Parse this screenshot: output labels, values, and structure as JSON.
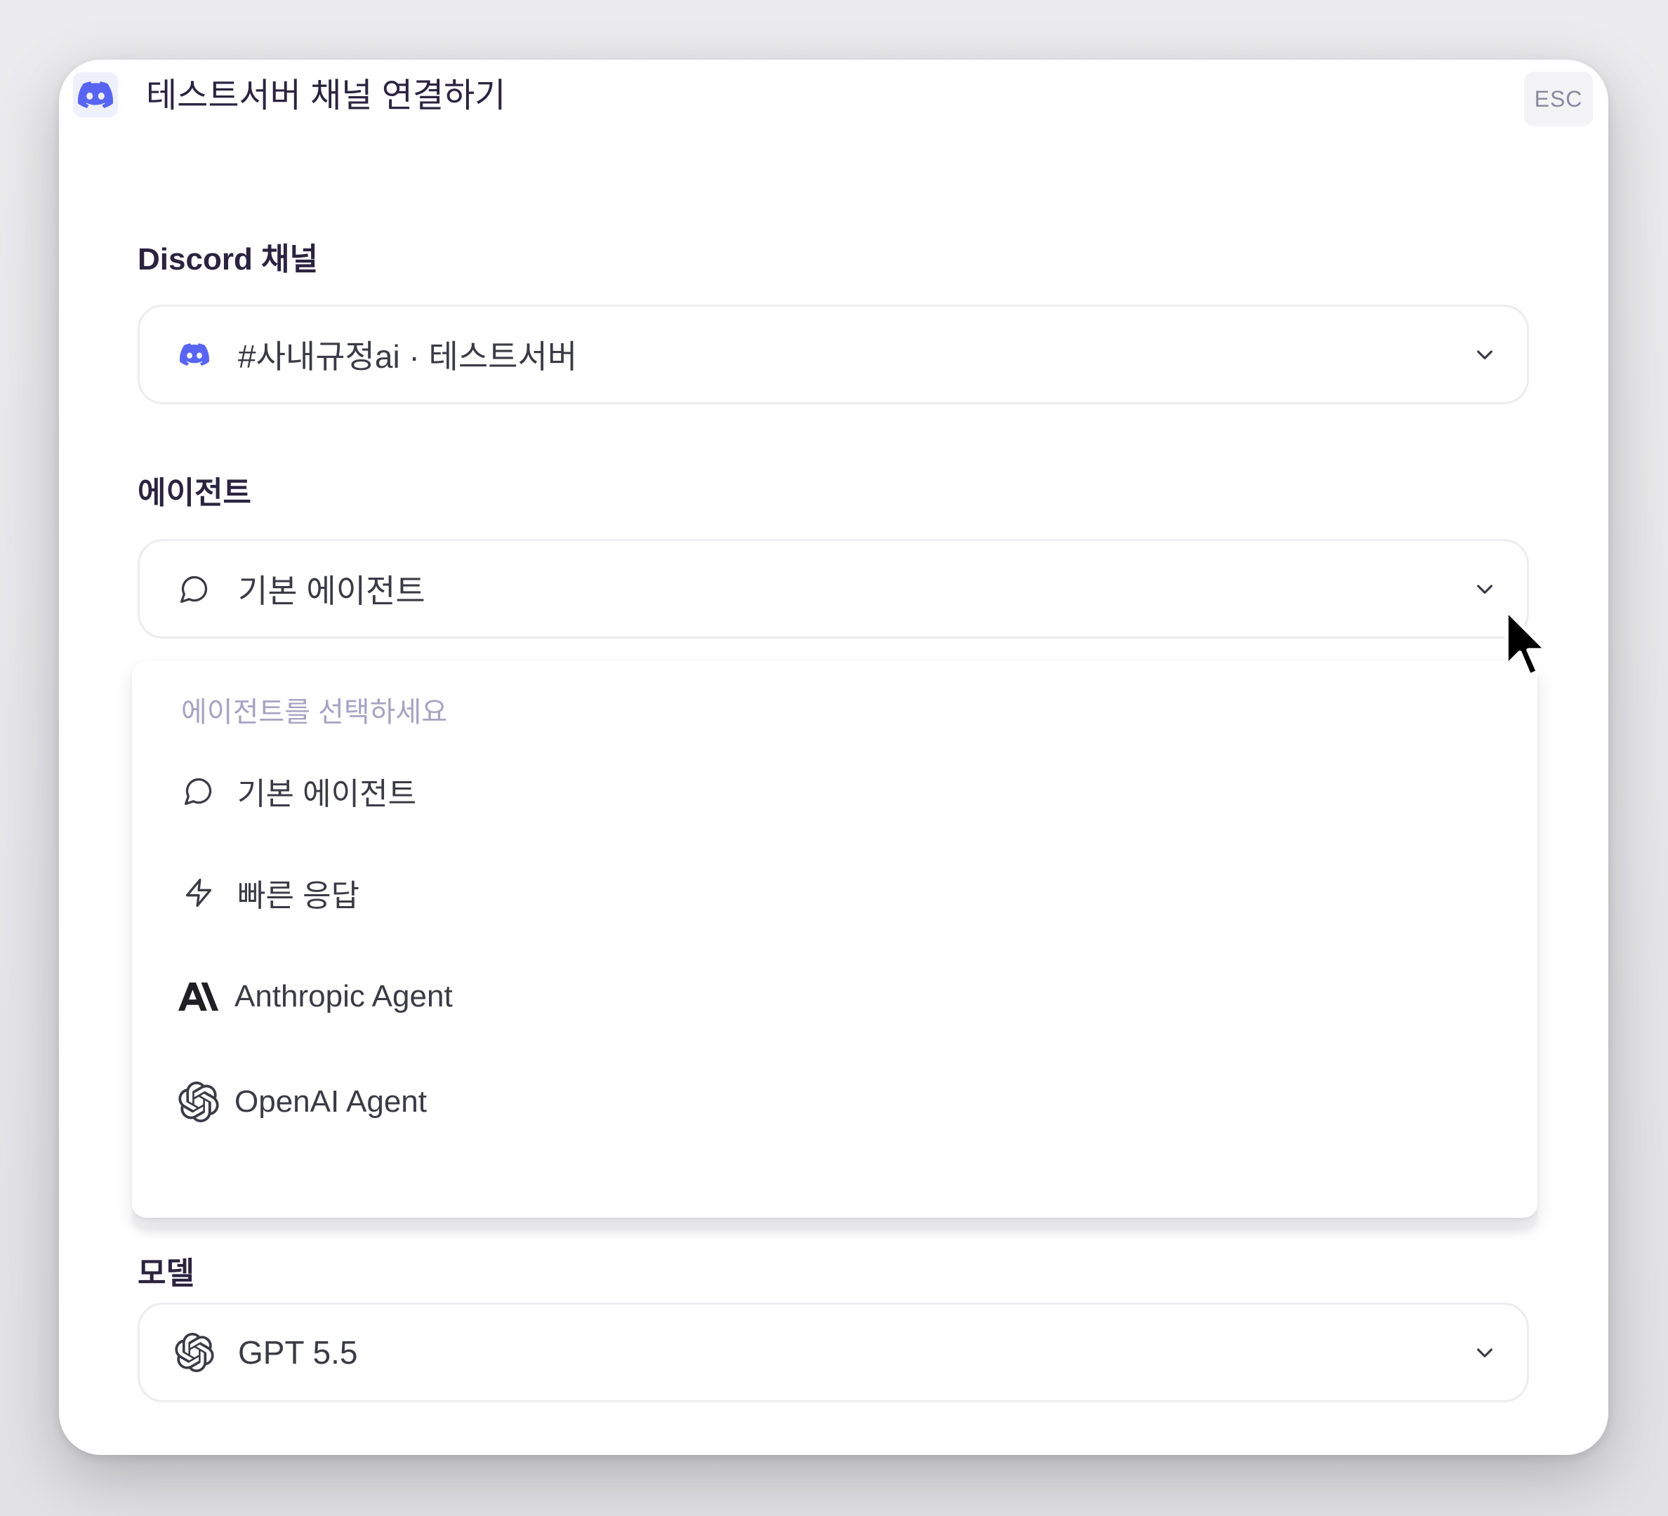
{
  "header": {
    "title": "테스트서버 채널 연결하기",
    "esc_label": "ESC",
    "icon": "discord-icon"
  },
  "discord_channel": {
    "label": "Discord 채널",
    "value": "#사내규정ai · 테스트서버",
    "icon": "discord-icon"
  },
  "agent": {
    "label": "에이전트",
    "value": "기본 에이전트",
    "icon": "chat-bubble-icon",
    "expanded": true,
    "dropdown": {
      "placeholder": "에이전트를 선택하세요",
      "options": [
        {
          "label": "기본 에이전트",
          "icon": "chat-bubble-icon"
        },
        {
          "label": "빠른 응답",
          "icon": "lightning-icon"
        },
        {
          "label": "Anthropic Agent",
          "icon": "anthropic-logo-icon"
        },
        {
          "label": "OpenAI Agent",
          "icon": "openai-logo-icon"
        }
      ]
    }
  },
  "model": {
    "label": "모델",
    "value": "GPT 5.5",
    "icon": "openai-logo-icon"
  },
  "colors": {
    "discord_blurple": "#5865F2",
    "text_primary": "#2a2440",
    "placeholder": "#a7a3c2",
    "border": "#ececf1"
  }
}
